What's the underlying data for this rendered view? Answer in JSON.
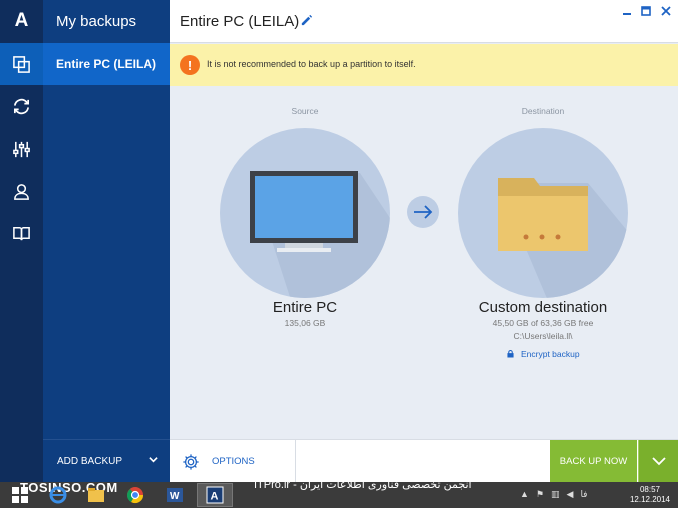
{
  "app": {
    "logo_letter": "A"
  },
  "rail": {
    "items": [
      {
        "icon": "copy-icon",
        "active": true
      },
      {
        "icon": "sync-icon",
        "active": false
      },
      {
        "icon": "tools-icon",
        "active": false
      },
      {
        "icon": "account-icon",
        "active": false
      },
      {
        "icon": "book-icon",
        "active": false
      }
    ]
  },
  "panel": {
    "title": "My backups",
    "items": [
      {
        "label": "Entire PC (LEILA)"
      }
    ],
    "add_backup_label": "ADD BACKUP"
  },
  "header": {
    "title": "Entire PC (LEILA)"
  },
  "warning": {
    "text": "It is not recommended to back up a partition to itself."
  },
  "source": {
    "caption": "Source",
    "name": "Entire PC",
    "size": "135,06 GB"
  },
  "destination": {
    "caption": "Destination",
    "name": "Custom destination",
    "space": "45,50 GB of 63,36 GB free",
    "path": "C:\\Users\\leila.ll\\",
    "encrypt_label": "Encrypt backup"
  },
  "footer": {
    "options_label": "OPTIONS",
    "backup_now_label": "BACK UP NOW"
  },
  "taskbar": {
    "watermark": "TOSINSO.COM",
    "watermark_right": "ITPro.ir - انجمن تخصصی فناوری اطلاعات ایران",
    "lang": "فا",
    "time": "08:57",
    "date": "12.12.2014"
  },
  "colors": {
    "rail": "#0f2d5c",
    "panel": "#0e3e80",
    "active": "#1166c9",
    "warning_bg": "#fbf2a9",
    "warning_icon": "#f4731f",
    "circle": "#bdcde4",
    "backup_button": "#85bb35",
    "link": "#1e63c4"
  }
}
